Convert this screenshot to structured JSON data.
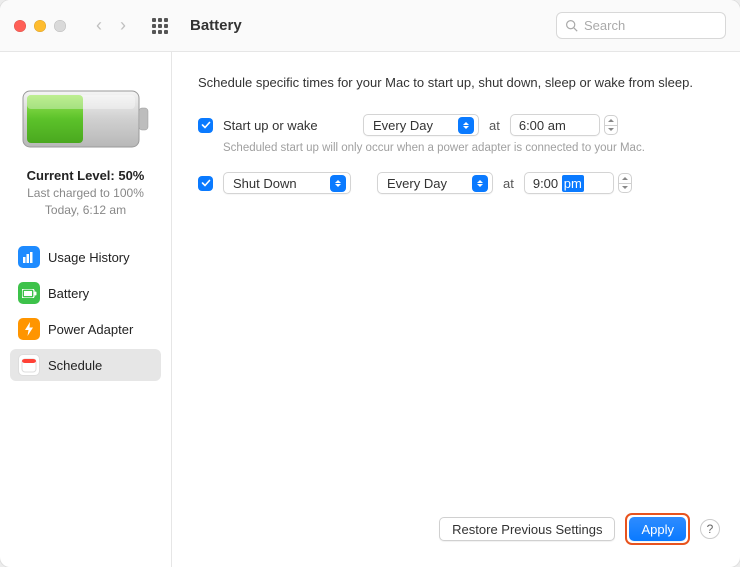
{
  "window_title": "Battery",
  "search_placeholder": "Search",
  "battery": {
    "level_label": "Current Level: 50%",
    "last_charged": "Last charged to 100%",
    "last_charged_time": "Today, 6:12 am"
  },
  "sidebar": {
    "items": [
      {
        "label": "Usage History"
      },
      {
        "label": "Battery"
      },
      {
        "label": "Power Adapter"
      },
      {
        "label": "Schedule"
      }
    ]
  },
  "content": {
    "description": "Schedule specific times for your Mac to start up, shut down, sleep or wake from sleep.",
    "row1": {
      "label": "Start up or wake",
      "day": "Every Day",
      "at": "at",
      "time": "6:00 am"
    },
    "hint": "Scheduled start up will only occur when a power adapter is connected to your Mac.",
    "row2": {
      "action": "Shut Down",
      "day": "Every Day",
      "at": "at",
      "time_num": "9:00",
      "time_ampm": "pm"
    }
  },
  "footer": {
    "restore": "Restore Previous Settings",
    "apply": "Apply"
  }
}
